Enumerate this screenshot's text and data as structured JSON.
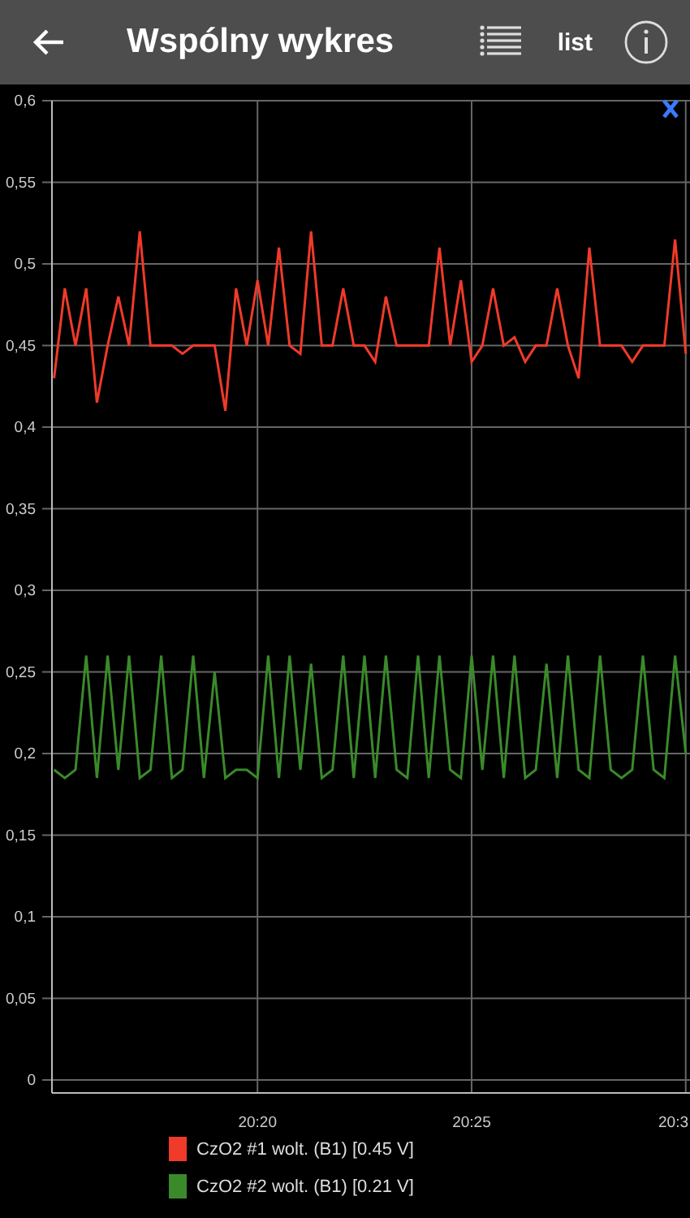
{
  "header": {
    "title": "Wspólny wykres",
    "list_label": "list"
  },
  "chart": {
    "chart_data": {
      "type": "line",
      "categories": [
        null,
        null,
        null,
        null,
        null,
        null,
        null,
        null,
        null,
        null,
        null,
        null,
        null,
        null,
        null,
        null,
        null,
        null,
        null,
        "20:20",
        null,
        null,
        null,
        null,
        null,
        null,
        null,
        null,
        null,
        null,
        null,
        null,
        null,
        null,
        null,
        null,
        null,
        null,
        null,
        "20:25",
        null,
        null,
        null,
        null,
        null,
        null,
        null,
        null,
        null,
        null,
        null,
        null,
        null,
        null,
        null,
        null,
        null,
        null,
        null,
        "20:3"
      ],
      "ylim": [
        0,
        0.6
      ],
      "grid": true,
      "yticks": [
        {
          "value": 0,
          "label": "0"
        },
        {
          "value": 0.05,
          "label": "0,05"
        },
        {
          "value": 0.1,
          "label": "0,1"
        },
        {
          "value": 0.15,
          "label": "0,15"
        },
        {
          "value": 0.2,
          "label": "0,2"
        },
        {
          "value": 0.25,
          "label": "0,25"
        },
        {
          "value": 0.3,
          "label": "0,3"
        },
        {
          "value": 0.35,
          "label": "0,35"
        },
        {
          "value": 0.4,
          "label": "0,4"
        },
        {
          "value": 0.45,
          "label": "0,45"
        },
        {
          "value": 0.5,
          "label": "0,5"
        },
        {
          "value": 0.55,
          "label": "0,55"
        },
        {
          "value": 0.6,
          "label": "0,6"
        }
      ],
      "series": [
        {
          "name": "CzO2 #1 wolt. (B1) [0.45 V]",
          "color": "#f03a2a",
          "values": [
            0.43,
            0.485,
            0.45,
            0.485,
            0.415,
            0.45,
            0.48,
            0.45,
            0.52,
            0.45,
            0.45,
            0.45,
            0.445,
            0.45,
            0.45,
            0.45,
            0.41,
            0.485,
            0.45,
            0.49,
            0.45,
            0.51,
            0.45,
            0.445,
            0.52,
            0.45,
            0.45,
            0.485,
            0.45,
            0.45,
            0.44,
            0.48,
            0.45,
            0.45,
            0.45,
            0.45,
            0.51,
            0.45,
            0.49,
            0.44,
            0.45,
            0.485,
            0.45,
            0.455,
            0.44,
            0.45,
            0.45,
            0.485,
            0.45,
            0.43,
            0.51,
            0.45,
            0.45,
            0.45,
            0.44,
            0.45,
            0.45,
            0.45,
            0.515,
            0.445
          ]
        },
        {
          "name": "CzO2 #2 wolt. (B1) [0.21 V]",
          "color": "#3a8a2a",
          "values": [
            0.19,
            0.185,
            0.19,
            0.26,
            0.185,
            0.26,
            0.19,
            0.26,
            0.185,
            0.19,
            0.26,
            0.185,
            0.19,
            0.26,
            0.185,
            0.25,
            0.185,
            0.19,
            0.19,
            0.185,
            0.26,
            0.185,
            0.26,
            0.19,
            0.255,
            0.185,
            0.19,
            0.26,
            0.185,
            0.26,
            0.185,
            0.26,
            0.19,
            0.185,
            0.26,
            0.185,
            0.26,
            0.19,
            0.185,
            0.26,
            0.19,
            0.26,
            0.185,
            0.26,
            0.185,
            0.19,
            0.255,
            0.185,
            0.26,
            0.19,
            0.185,
            0.26,
            0.19,
            0.185,
            0.19,
            0.26,
            0.19,
            0.185,
            0.26,
            0.2
          ]
        }
      ]
    }
  }
}
